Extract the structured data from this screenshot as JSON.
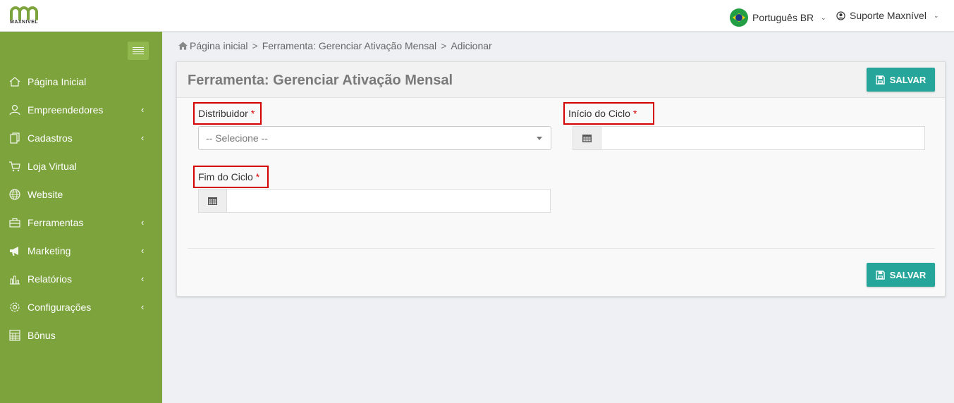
{
  "brand": {
    "name": "MAXNIVEL",
    "color": "#7da33d"
  },
  "topbar": {
    "language": "Português BR",
    "user": "Suporte Maxnível"
  },
  "sidebar": {
    "items": [
      {
        "label": "Página Inicial",
        "icon": "home-icon",
        "has_arrow": false
      },
      {
        "label": "Empreendedores",
        "icon": "user-icon",
        "has_arrow": true
      },
      {
        "label": "Cadastros",
        "icon": "documents-icon",
        "has_arrow": true
      },
      {
        "label": "Loja Virtual",
        "icon": "cart-icon",
        "has_arrow": false
      },
      {
        "label": "Website",
        "icon": "globe-icon",
        "has_arrow": false
      },
      {
        "label": "Ferramentas",
        "icon": "toolbox-icon",
        "has_arrow": true
      },
      {
        "label": "Marketing",
        "icon": "megaphone-icon",
        "has_arrow": true
      },
      {
        "label": "Relatórios",
        "icon": "bar-chart-icon",
        "has_arrow": true
      },
      {
        "label": "Configurações",
        "icon": "gear-icon",
        "has_arrow": true
      },
      {
        "label": "Bônus",
        "icon": "calculator-icon",
        "has_arrow": false
      }
    ],
    "arrow": "‹"
  },
  "breadcrumb": {
    "items": [
      "Página inicial",
      "Ferramenta: Gerenciar Ativação Mensal",
      "Adicionar"
    ],
    "separator": ">"
  },
  "panel": {
    "title": "Ferramenta: Gerenciar Ativação Mensal",
    "save_label": "SALVAR"
  },
  "form": {
    "required_mark": "*",
    "distribuidor": {
      "label": "Distribuidor",
      "placeholder": "-- Selecione --"
    },
    "inicio": {
      "label": "Início do Ciclo",
      "value": ""
    },
    "fim": {
      "label": "Fim do Ciclo",
      "value": ""
    }
  },
  "colors": {
    "sidebar": "#7da33d",
    "button": "#26a69a",
    "required": "#d40000"
  }
}
